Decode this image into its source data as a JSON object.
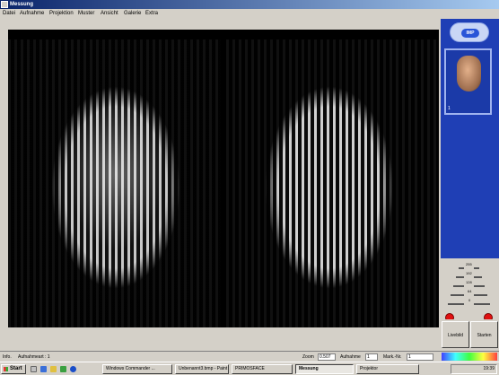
{
  "window": {
    "title": "Messung"
  },
  "menu": [
    "Datei",
    "Aufnahme",
    "Projektion",
    "Muster",
    "Ansicht",
    "Galerie",
    "Extra"
  ],
  "sidebar": {
    "logo_text": "IMP",
    "thumbnail_number": "1",
    "meter_labels": [
      "255",
      "192",
      "128",
      "64",
      "0"
    ],
    "left_label": "L",
    "right_label": "R",
    "buttons": [
      "Livebild",
      "Starten"
    ]
  },
  "status": {
    "info": "Info.",
    "aufnahmeart": "Aufnahmeart : 1",
    "zoom_label": "Zoom",
    "zoom_value": "0.507",
    "aufnahme_label": "Aufnahme",
    "aufnahme_value": "1",
    "mark_label": "Mark.-Nr.",
    "mark_value": "1"
  },
  "taskbar": {
    "start": "Start",
    "tasks": [
      "Windows Commander ...",
      "Unbenannt3.bmp - Paint",
      "PRIMOSFACE",
      "Messung",
      "Projektor"
    ],
    "clock": "19:39"
  }
}
